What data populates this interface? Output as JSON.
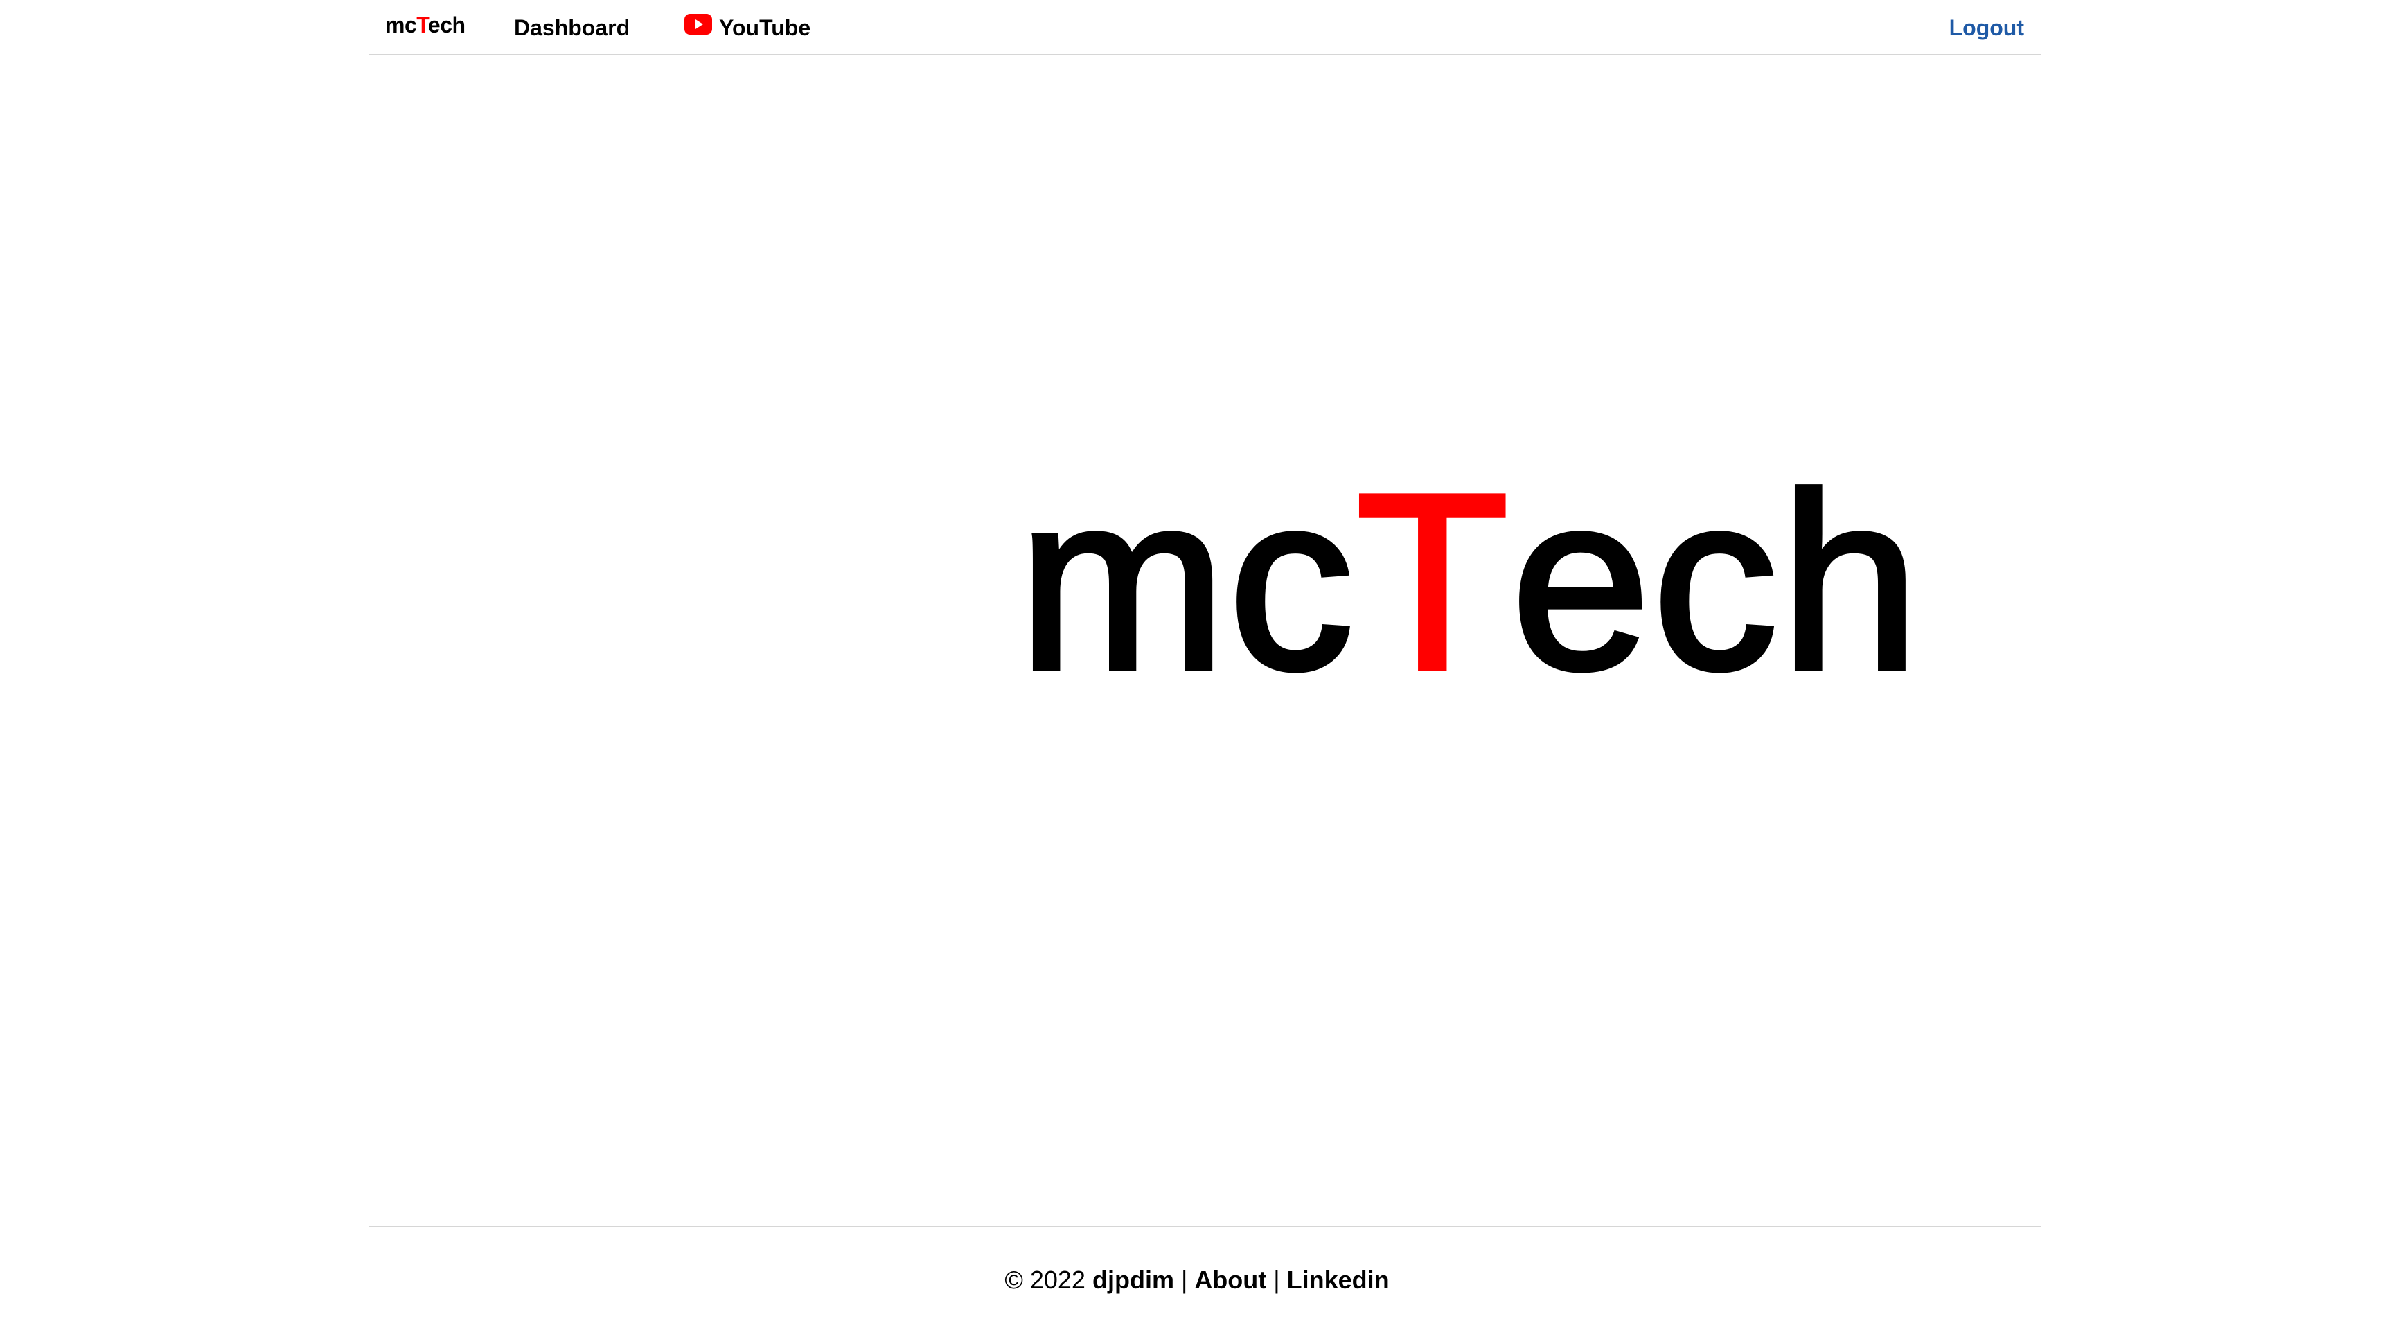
{
  "navbar": {
    "brand": {
      "prefix": "mc",
      "highlight": "T",
      "suffix": "ech"
    },
    "dashboard_label": "Dashboard",
    "youtube_label": "YouTube",
    "youtube_icon": "youtube-play-icon",
    "logout_label": "Logout"
  },
  "hero": {
    "prefix": "mc",
    "highlight": "T",
    "suffix": "ech"
  },
  "footer": {
    "copyright": "© 2022",
    "author": "djpdim",
    "separator": "|",
    "about_label": "About",
    "linkedin_label": "Linkedin"
  },
  "colors": {
    "brand_red": "#ff0000",
    "logout_blue": "#1f5aa6",
    "divider": "#d6d6d6",
    "text": "#000000",
    "background": "#ffffff"
  }
}
